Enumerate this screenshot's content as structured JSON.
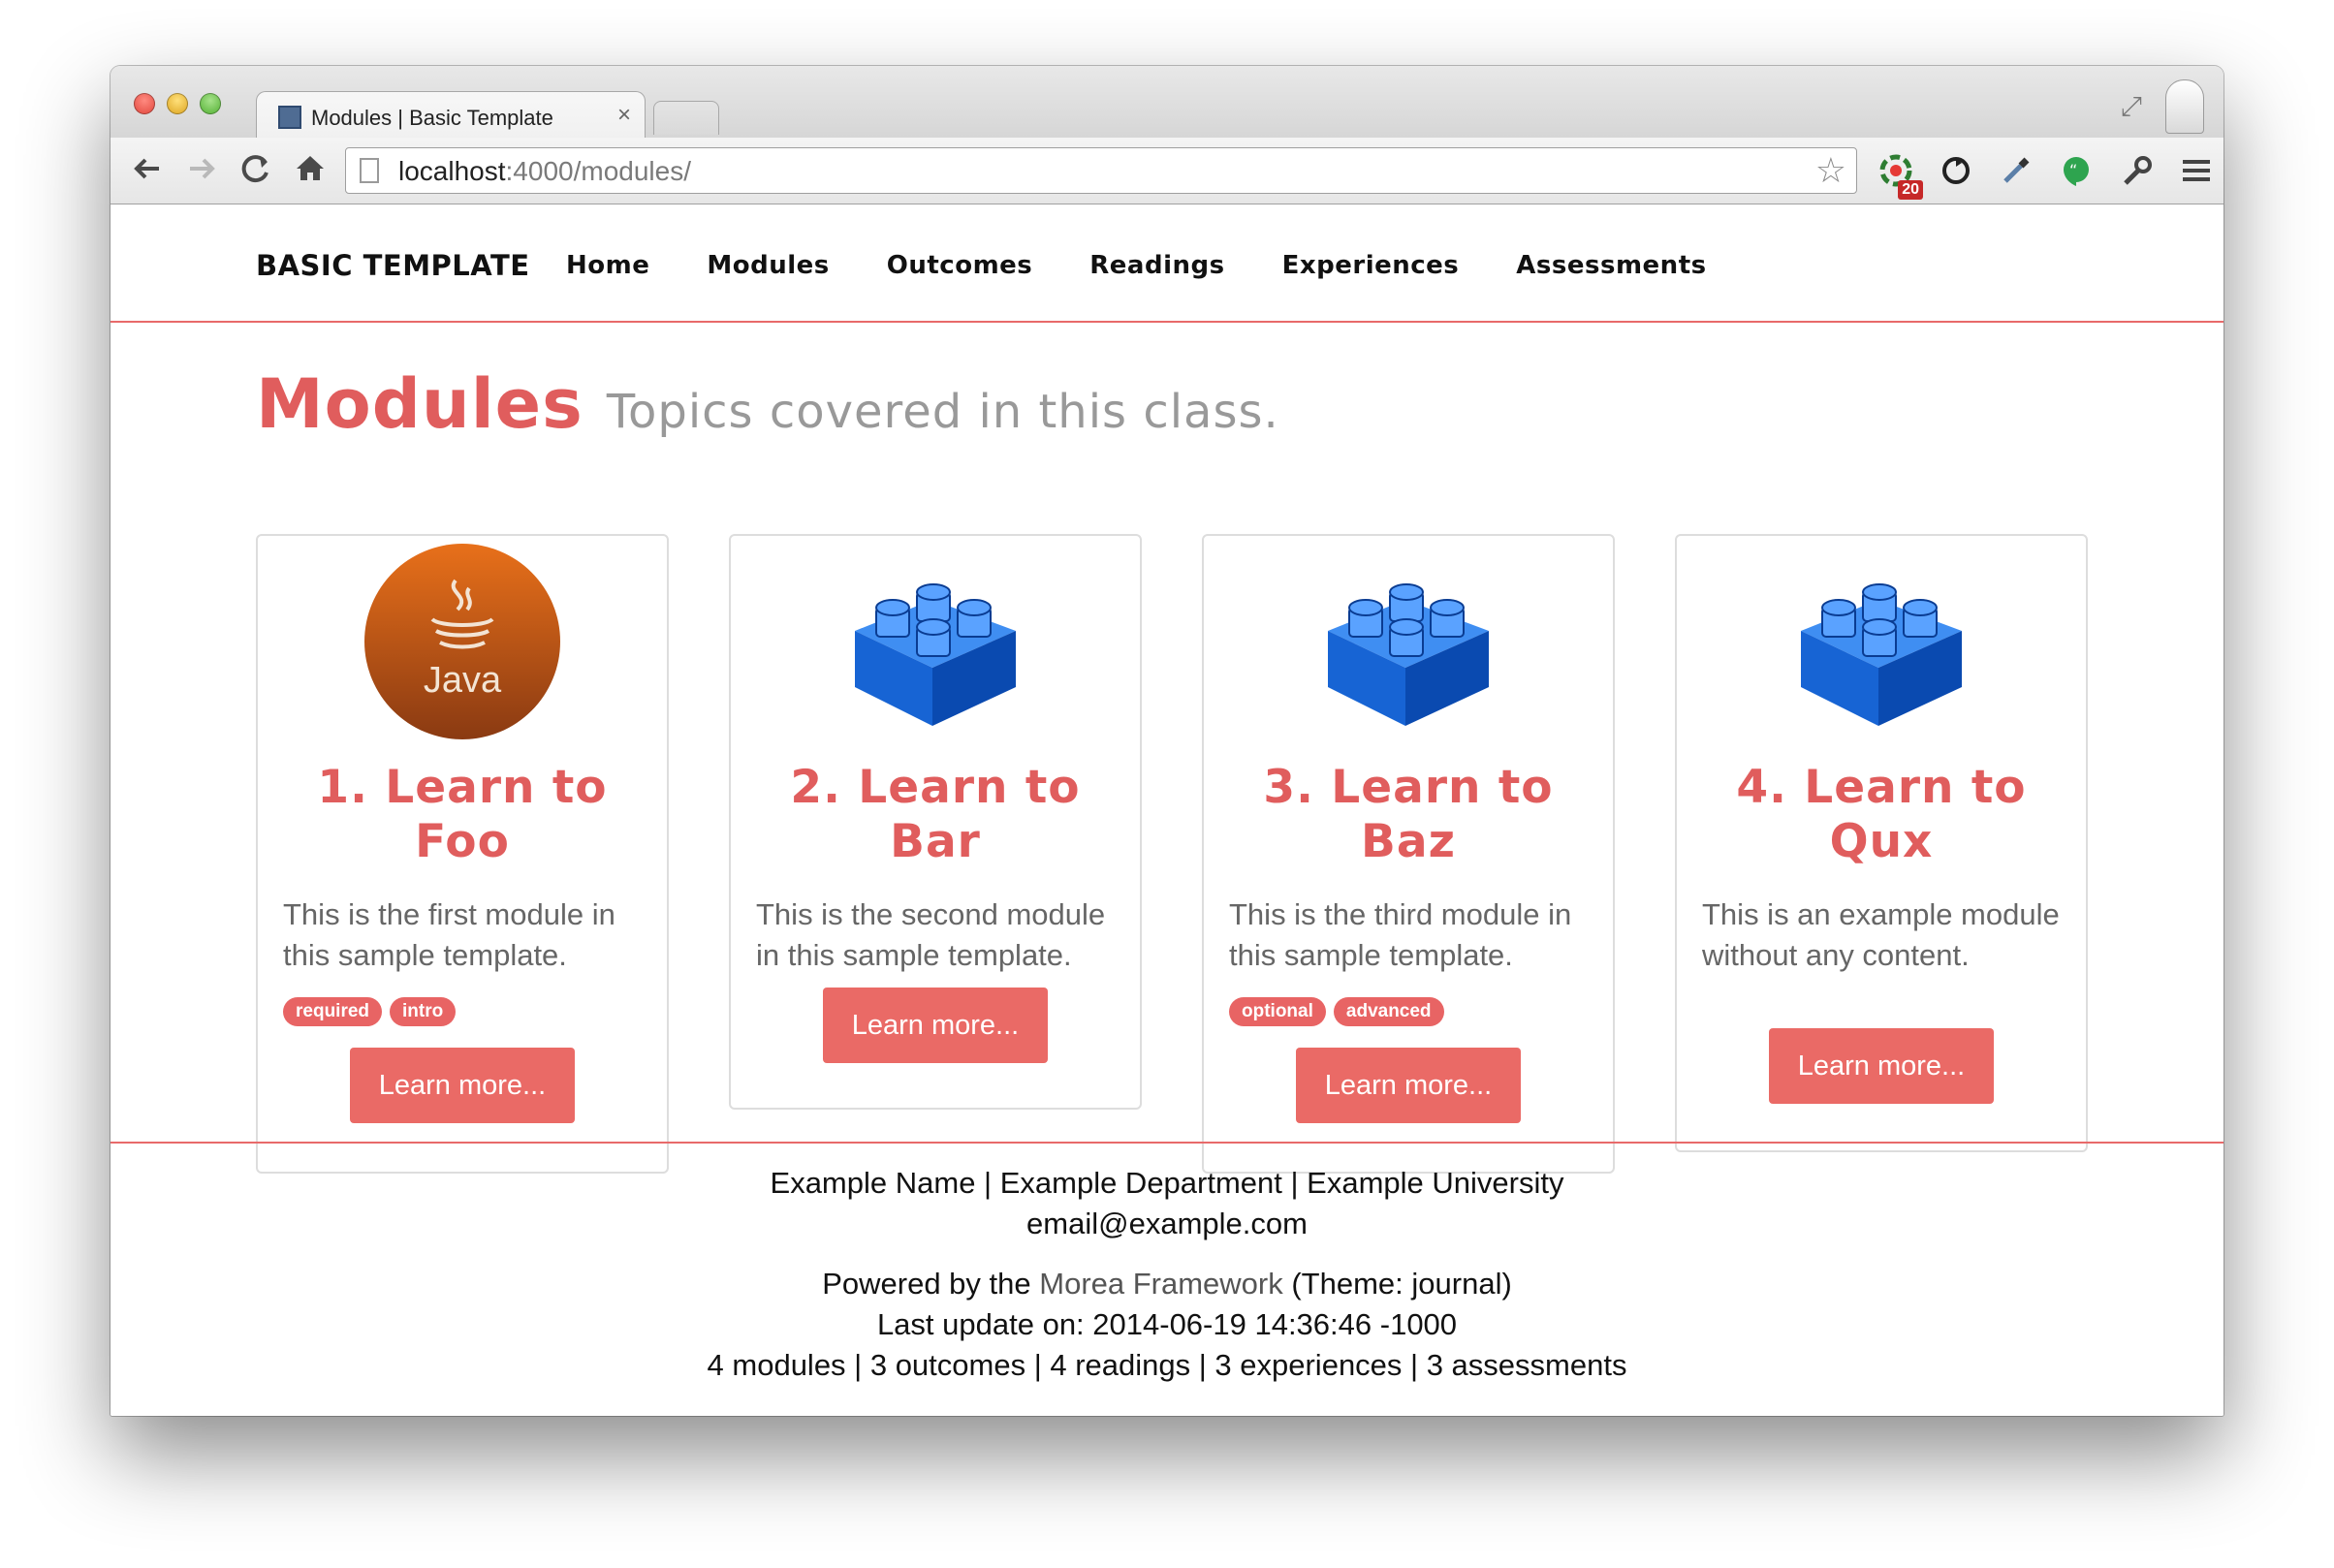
{
  "browser": {
    "tab_title": "Modules | Basic Template",
    "tab_close": "×",
    "url_host": "localhost",
    "url_rest": ":4000/modules/",
    "extension_badge": "20"
  },
  "site": {
    "brand": "BASIC TEMPLATE",
    "nav": [
      "Home",
      "Modules",
      "Outcomes",
      "Readings",
      "Experiences",
      "Assessments"
    ],
    "accent_color": "#e05d5d"
  },
  "header": {
    "title": "Modules",
    "subtitle": "Topics covered in this class."
  },
  "modules": [
    {
      "title_line1": "1. Learn to",
      "title_line2": "Foo",
      "description": "This is the first module in this sample template.",
      "labels": [
        "required",
        "intro"
      ],
      "button": "Learn more...",
      "icon": "java-logo-icon",
      "icon_text": "Java"
    },
    {
      "title_line1": "2. Learn to",
      "title_line2": "Bar",
      "description": "This is the second module in this sample template.",
      "labels": [],
      "button": "Learn more...",
      "icon": "blue-lego-block-icon"
    },
    {
      "title_line1": "3. Learn to",
      "title_line2": "Baz",
      "description": "This is the third module in this sample template.",
      "labels": [
        "optional",
        "advanced"
      ],
      "button": "Learn more...",
      "icon": "blue-lego-block-icon"
    },
    {
      "title_line1": "4. Learn to",
      "title_line2": "Qux",
      "description": "This is an example module without any content.",
      "labels": [],
      "button": "Learn more...",
      "icon": "blue-lego-block-icon"
    }
  ],
  "footer": {
    "line1": "Example Name | Example Department | Example University",
    "line2": "email@example.com",
    "powered_prefix": "Powered by the ",
    "powered_link": "Morea Framework",
    "powered_suffix": " (Theme: journal)",
    "last_update": "Last update on: 2014-06-19 14:36:46 -1000",
    "stats": "4 modules | 3 outcomes | 4 readings | 3 experiences | 3 assessments"
  }
}
